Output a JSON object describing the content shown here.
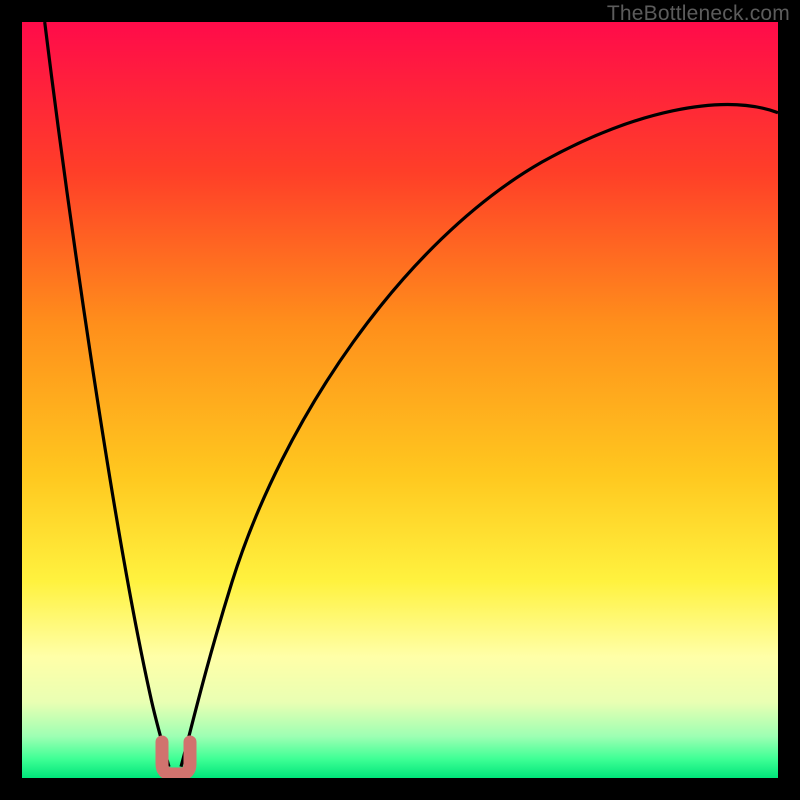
{
  "watermark": "TheBottleneck.com",
  "chart_data": {
    "type": "line",
    "title": "",
    "xlabel": "",
    "ylabel": "",
    "xlim": [
      0,
      100
    ],
    "ylim": [
      0,
      100
    ],
    "grid": false,
    "series": [
      {
        "name": "bottleneck-curve",
        "description": "Bottleneck percentage (y) vs relative performance (x). Minimum near x≈20 where bottleneck ≈0; rises steeply toward x→0 and asymptotically toward ~88 as x→100.",
        "x": [
          3,
          5,
          7,
          9,
          11,
          13,
          15,
          17,
          18,
          19,
          19.5,
          20,
          20.5,
          21,
          22,
          23,
          25,
          28,
          32,
          37,
          43,
          50,
          58,
          67,
          77,
          88,
          100
        ],
        "y": [
          100,
          86,
          72,
          59,
          47,
          36,
          26,
          15,
          10,
          5,
          2.5,
          1.5,
          2.5,
          5,
          10,
          15,
          23,
          32,
          41,
          50,
          58,
          65,
          71,
          76,
          80,
          84,
          88
        ]
      }
    ],
    "background_gradient": {
      "stops": [
        {
          "pos": 0.0,
          "color": "#ff0b4a"
        },
        {
          "pos": 0.2,
          "color": "#ff3f28"
        },
        {
          "pos": 0.4,
          "color": "#ff8f1b"
        },
        {
          "pos": 0.6,
          "color": "#ffc81f"
        },
        {
          "pos": 0.74,
          "color": "#fff23f"
        },
        {
          "pos": 0.84,
          "color": "#ffffa8"
        },
        {
          "pos": 0.9,
          "color": "#e9ffb3"
        },
        {
          "pos": 0.945,
          "color": "#9dffb3"
        },
        {
          "pos": 0.975,
          "color": "#3eff95"
        },
        {
          "pos": 1.0,
          "color": "#00e57a"
        }
      ]
    },
    "marker": {
      "name": "optimal-point",
      "x": 20,
      "y": 2,
      "color": "#d1736e"
    }
  }
}
